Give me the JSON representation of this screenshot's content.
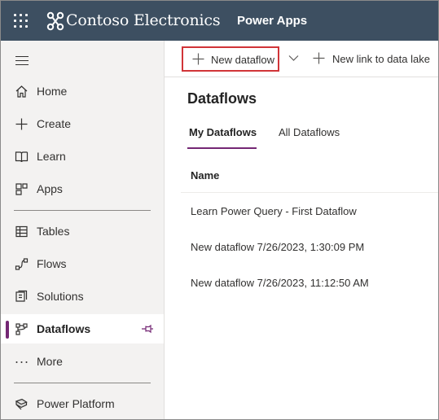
{
  "header": {
    "brand": "Contoso Electronics",
    "app_name": "Power Apps"
  },
  "sidebar": {
    "items": [
      {
        "label": "Home",
        "icon": "home-icon"
      },
      {
        "label": "Create",
        "icon": "plus-icon"
      },
      {
        "label": "Learn",
        "icon": "book-icon"
      },
      {
        "label": "Apps",
        "icon": "apps-icon"
      },
      {
        "label": "Tables",
        "icon": "table-icon"
      },
      {
        "label": "Flows",
        "icon": "flow-icon"
      },
      {
        "label": "Solutions",
        "icon": "solutions-icon"
      },
      {
        "label": "Dataflows",
        "icon": "dataflow-icon",
        "active": true
      },
      {
        "label": "More",
        "icon": "more-icon"
      },
      {
        "label": "Power Platform",
        "icon": "power-platform-icon"
      }
    ]
  },
  "toolbar": {
    "new_dataflow": "New dataflow",
    "new_link": "New link to data lake"
  },
  "main": {
    "title": "Dataflows",
    "tabs": [
      "My Dataflows",
      "All Dataflows"
    ],
    "selected_tab": "My Dataflows",
    "column_name": "Name",
    "rows": [
      "Learn Power Query - First Dataflow",
      "New dataflow 7/26/2023, 1:30:09 PM",
      "New dataflow 7/26/2023, 11:12:50 AM"
    ]
  },
  "colors": {
    "header_bg": "#3d4f61",
    "accent": "#742774",
    "highlight_box": "#d13438"
  }
}
